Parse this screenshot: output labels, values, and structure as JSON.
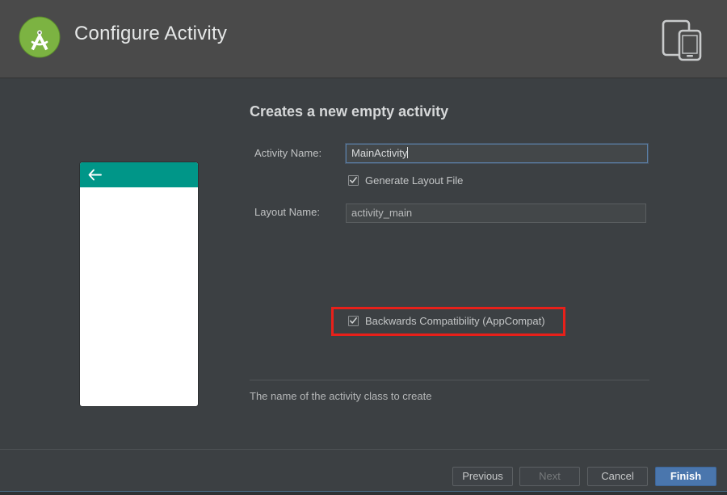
{
  "header": {
    "title": "Configure Activity",
    "logo_icon": "android-studio-logo",
    "device_icon": "tablet-phone-icon"
  },
  "main": {
    "section_title": "Creates a new empty activity",
    "preview": {
      "name": "activity-preview",
      "appbar_color": "#009688",
      "content_color": "#ffffff",
      "back_icon": "back-arrow-icon"
    },
    "fields": {
      "activity_name": {
        "label": "Activity Name:",
        "value": "MainActivity",
        "placeholder": "Activity Name",
        "focused": true
      },
      "layout_name": {
        "label": "Layout Name:",
        "value": "activity_main",
        "placeholder": "Layout Name",
        "focused": false
      }
    },
    "checkboxes": {
      "generate_layout": {
        "label": "Generate Layout File",
        "checked": true
      },
      "backwards_compatibility": {
        "label": "Backwards Compatibility (AppCompat)",
        "checked": true,
        "highlighted": true
      }
    },
    "hint_text": "The name of the activity class to create"
  },
  "footer": {
    "buttons": {
      "previous": "Previous",
      "next": "Next",
      "cancel": "Cancel",
      "finish": "Finish"
    }
  },
  "colors": {
    "header_bg": "#4a4a4a",
    "body_bg": "#3c4043",
    "accent_teal": "#009688",
    "accent_blue": "#4a76ad",
    "annotation_red": "#e8201a",
    "logo_green": "#7cb342"
  }
}
